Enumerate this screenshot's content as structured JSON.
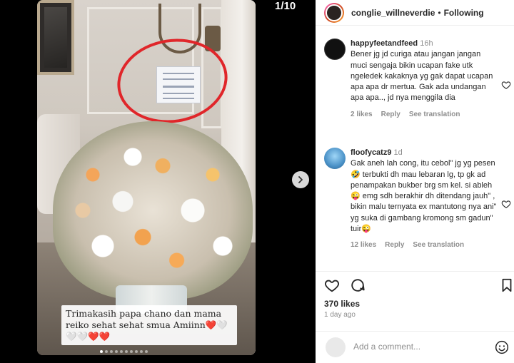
{
  "media": {
    "counter": "1/10",
    "caption": "Trimakasih papa chano dan mama reiko sehat sehat smua Amiinn❤️🤍🤍🤍❤️❤️",
    "dots_total": 10,
    "dots_active": 1
  },
  "post": {
    "username": "conglie_willneverdie",
    "follow_status": "Following"
  },
  "comments": [
    {
      "username": "happyfeetandfeed",
      "time": "16h",
      "text": "Bener jg jd curiga atau jangan jangan muci sengaja bikin ucapan fake utk ngeledek kakaknya yg gak dapat ucapan apa apa dr mertua. Gak ada undangan apa apa.., jd nya menggila dia",
      "likes": "2 likes",
      "reply": "Reply",
      "translation": "See translation"
    },
    {
      "username": "floofycatz9",
      "time": "1d",
      "text": "Gak aneh lah cong, itu cebol\" jg yg pesen 🤣 terbukti dh mau lebaran lg, tp gk ad penampakan bukber brg sm kel. si ableh😜 emg sdh berakhir dh ditendang jauh\" , bikin malu ternyata ex mantutong nya ani\" yg suka di gambang kromong sm gadun\" tuir😜",
      "likes": "12 likes",
      "reply": "Reply",
      "translation": "See translation"
    }
  ],
  "actions": {
    "likes": "370 likes",
    "age": "1 day ago"
  },
  "add_comment": {
    "placeholder": "Add a comment..."
  },
  "icons": [
    "chevron-right-icon",
    "heart-icon",
    "comment-icon",
    "bookmark-icon",
    "emoji-icon"
  ]
}
